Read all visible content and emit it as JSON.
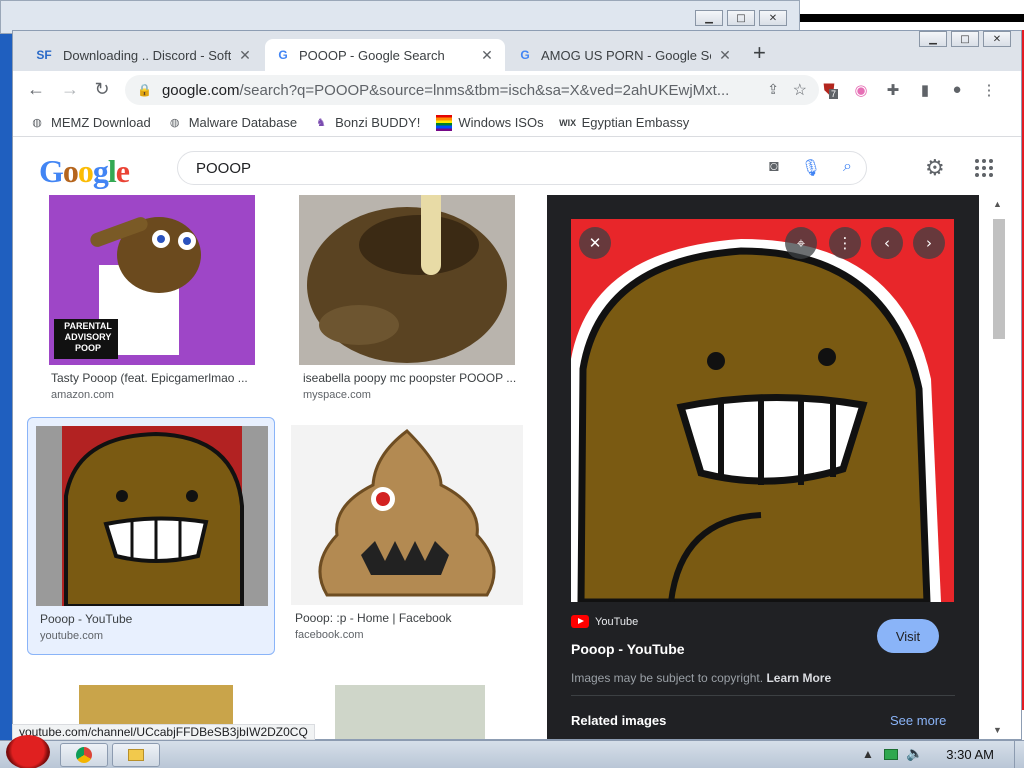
{
  "browser": {
    "tabs": [
      {
        "favicon": "SF",
        "title": "Downloading .. Discord - Soft",
        "active": false
      },
      {
        "favicon": "G",
        "title": "POOOP - Google Search",
        "active": true
      },
      {
        "favicon": "G",
        "title": "AMOG US PORN - Google Sea",
        "active": false
      }
    ],
    "new_tab": "+",
    "url_host": "google.com",
    "url_rest": "/search?q=POOOP&source=lnms&tbm=isch&sa=X&ved=2ahUKEwjMxt...",
    "extension_badge": "7",
    "bookmarks": [
      {
        "label": "MEMZ Download",
        "icon": "globe-icon"
      },
      {
        "label": "Malware Database",
        "icon": "globe-icon"
      },
      {
        "label": "Bonzi BUDDY!",
        "icon": "bonzi-icon"
      },
      {
        "label": "Windows ISOs",
        "icon": "rainbow-flag-icon"
      },
      {
        "label": "Egyptian Embassy",
        "icon": "wix-icon"
      }
    ]
  },
  "google": {
    "logo": "Google",
    "query": "POOOP",
    "results": [
      {
        "title": "Tasty Pooop (feat. Epicgamerlmao ...",
        "source": "amazon.com",
        "label": "PARENTAL ADVISORY POOP"
      },
      {
        "title": "iseabella poopy mc poopster POOOP ...",
        "source": "myspace.com"
      },
      {
        "title": "Pooop - YouTube",
        "source": "youtube.com",
        "selected": true
      },
      {
        "title": "Pooop: :p - Home | Facebook",
        "source": "facebook.com"
      }
    ],
    "preview": {
      "source": "YouTube",
      "title": "Pooop - YouTube",
      "visit": "Visit",
      "copyright": "Images may be subject to copyright.",
      "learn_more": "Learn More",
      "related": "Related images",
      "see_more": "See more"
    }
  },
  "status_url": "youtube.com/channel/UCcabjFFDBeSB3jbIW2DZ0CQ",
  "taskbar": {
    "clock": "3:30 AM"
  }
}
